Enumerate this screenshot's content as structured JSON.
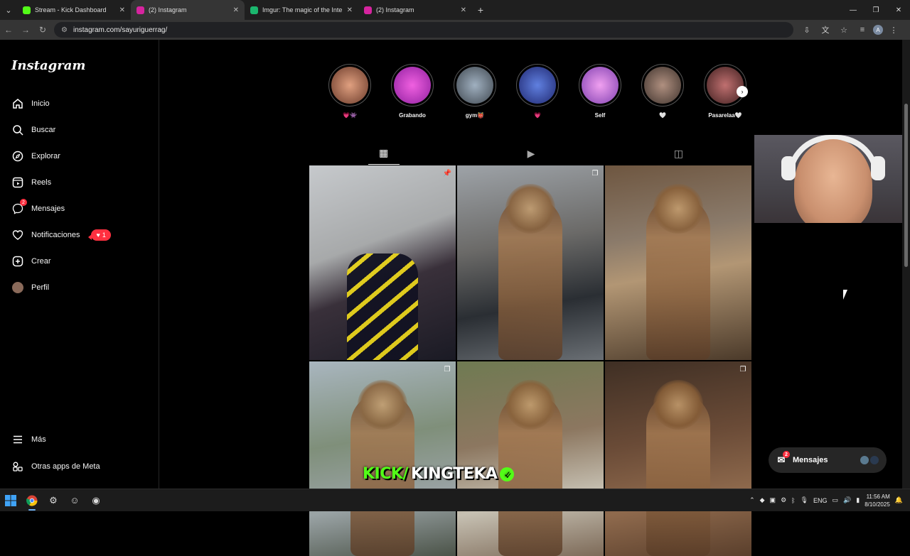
{
  "browser": {
    "tabs": [
      {
        "title": "Stream - Kick Dashboard",
        "favicon_color": "#53fc18",
        "active": false
      },
      {
        "title": "(2) Instagram",
        "favicon_color": "#d6249f",
        "active": true
      },
      {
        "title": "Imgur: The magic of the Interne",
        "favicon_color": "#1bb76e",
        "active": false
      },
      {
        "title": "(2) Instagram",
        "favicon_color": "#d6249f",
        "active": false
      }
    ],
    "url": "instagram.com/sayuriguerrag/",
    "profile_initial": "A"
  },
  "sidebar": {
    "logo": "Instagram",
    "items": [
      {
        "label": "Inicio",
        "icon": "home-icon"
      },
      {
        "label": "Buscar",
        "icon": "search-icon"
      },
      {
        "label": "Explorar",
        "icon": "compass-icon"
      },
      {
        "label": "Reels",
        "icon": "reels-icon"
      },
      {
        "label": "Mensajes",
        "icon": "messenger-icon",
        "badge": "2"
      },
      {
        "label": "Notificaciones",
        "icon": "heart-icon",
        "pill_count": "1"
      },
      {
        "label": "Crear",
        "icon": "plus-square-icon"
      },
      {
        "label": "Perfil",
        "icon": "avatar"
      }
    ],
    "bottom_items": [
      {
        "label": "Más",
        "icon": "menu-icon"
      },
      {
        "label": "Otras apps de Meta",
        "icon": "meta-apps-icon"
      }
    ]
  },
  "highlights": [
    {
      "label": "💗👾",
      "color": "#c08060"
    },
    {
      "label": "Grabando",
      "color": "#e040d0"
    },
    {
      "label": "gym👹",
      "color": "#8090a0"
    },
    {
      "label": "💗",
      "color": "#3050b0"
    },
    {
      "label": "Self",
      "color": "#d060e0"
    },
    {
      "label": "🤍",
      "color": "#706058"
    },
    {
      "label": "Pasarelaa🤍",
      "color": "#904848"
    }
  ],
  "profile_tabs": [
    {
      "name": "posts-tab",
      "glyph": "▦",
      "active": true
    },
    {
      "name": "reels-tab",
      "glyph": "▶",
      "active": false
    },
    {
      "name": "tagged-tab",
      "glyph": "◫",
      "active": false
    }
  ],
  "posts": [
    {
      "corner": "📌",
      "style": "p1"
    },
    {
      "corner": "❐",
      "style": "p2"
    },
    {
      "corner": "",
      "style": "p3"
    },
    {
      "corner": "❐",
      "style": "p4"
    },
    {
      "corner": "",
      "style": "p5"
    },
    {
      "corner": "❐",
      "style": "p6"
    }
  ],
  "messages_pill": {
    "label": "Mensajes",
    "badge": "2"
  },
  "overlay": {
    "part1": "KICK/",
    "part2": "KINGTEKA"
  },
  "taskbar": {
    "lang": "ENG",
    "time": "11:56 AM",
    "date": "8/10/2025"
  }
}
